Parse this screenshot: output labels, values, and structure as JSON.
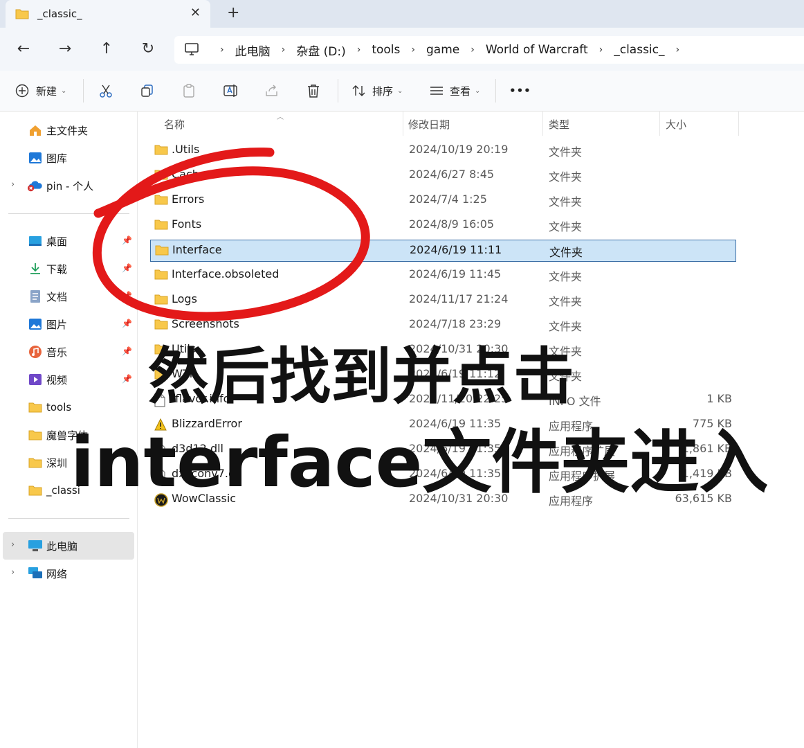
{
  "window": {
    "tab_title": "_classic_",
    "close_glyph": "✕",
    "new_tab_glyph": "+"
  },
  "nav": {
    "back": "←",
    "forward": "→",
    "up": "↑",
    "refresh": "↻"
  },
  "breadcrumbs": [
    "此电脑",
    "杂盘 (D:)",
    "tools",
    "game",
    "World of Warcraft",
    "_classic_"
  ],
  "toolbar": {
    "new_label": "新建",
    "sort_label": "排序",
    "view_label": "查看",
    "more_label": "•••"
  },
  "sidebar": {
    "quick": [
      {
        "label": "主文件夹",
        "icon": "home-icon"
      },
      {
        "label": "图库",
        "icon": "gallery-icon"
      },
      {
        "label": "pin - 个人",
        "icon": "onedrive-icon"
      }
    ],
    "pinned": [
      {
        "label": "桌面",
        "icon": "desktop-icon",
        "pinned": true
      },
      {
        "label": "下载",
        "icon": "download-icon",
        "pinned": true
      },
      {
        "label": "文档",
        "icon": "document-icon",
        "pinned": true
      },
      {
        "label": "图片",
        "icon": "pictures-icon",
        "pinned": true
      },
      {
        "label": "音乐",
        "icon": "music-icon",
        "pinned": true
      },
      {
        "label": "视频",
        "icon": "video-icon",
        "pinned": true
      },
      {
        "label": "tools",
        "icon": "folder-icon",
        "pinned": false
      },
      {
        "label": "魔兽字体",
        "icon": "folder-icon",
        "pinned": false
      },
      {
        "label": "深圳",
        "icon": "folder-icon",
        "pinned": false
      },
      {
        "label": "_classi",
        "icon": "folder-icon",
        "pinned": false
      }
    ],
    "this_pc": "此电脑",
    "network": "网络"
  },
  "columns": {
    "name": "名称",
    "date": "修改日期",
    "type": "类型",
    "size": "大小"
  },
  "files": [
    {
      "name": ".Utils",
      "date": "2024/10/19 20:19",
      "type": "文件夹",
      "size": "",
      "kind": "folder"
    },
    {
      "name": "Cache",
      "date": "2024/6/27 8:45",
      "type": "文件夹",
      "size": "",
      "kind": "folder"
    },
    {
      "name": "Errors",
      "date": "2024/7/4 1:25",
      "type": "文件夹",
      "size": "",
      "kind": "folder"
    },
    {
      "name": "Fonts",
      "date": "2024/8/9 16:05",
      "type": "文件夹",
      "size": "",
      "kind": "folder"
    },
    {
      "name": "Interface",
      "date": "2024/6/19 11:11",
      "type": "文件夹",
      "size": "",
      "kind": "folder",
      "selected": true
    },
    {
      "name": "Interface.obsoleted",
      "date": "2024/6/19 11:45",
      "type": "文件夹",
      "size": "",
      "kind": "folder"
    },
    {
      "name": "Logs",
      "date": "2024/11/17 21:24",
      "type": "文件夹",
      "size": "",
      "kind": "folder"
    },
    {
      "name": "Screenshots",
      "date": "2024/7/18 23:29",
      "type": "文件夹",
      "size": "",
      "kind": "folder"
    },
    {
      "name": "Utils",
      "date": "2024/10/31 20:30",
      "type": "文件夹",
      "size": "",
      "kind": "folder"
    },
    {
      "name": "WTF",
      "date": "2024/6/19 11:12",
      "type": "文件夹",
      "size": "",
      "kind": "folder"
    },
    {
      "name": ".flavor.info",
      "date": "2024/11/20 22:25",
      "type": "INFO 文件",
      "size": "1 KB",
      "kind": "file"
    },
    {
      "name": "BlizzardError",
      "date": "2024/6/19 11:35",
      "type": "应用程序",
      "size": "775 KB",
      "kind": "warn"
    },
    {
      "name": "d3d12.dll",
      "date": "2024/6/19 11:35",
      "type": "应用程序扩展",
      "size": "1,861 KB",
      "kind": "dll"
    },
    {
      "name": "dxilconv7.dll",
      "date": "2024/6/19 11:35",
      "type": "应用程序扩展",
      "size": "1,419 KB",
      "kind": "dll"
    },
    {
      "name": "WowClassic",
      "date": "2024/10/31 20:30",
      "type": "应用程序",
      "size": "63,615 KB",
      "kind": "exe"
    }
  ],
  "overlay": {
    "line1": "然后找到并点击",
    "line2": "interface文件夹进入"
  },
  "colors": {
    "accent_red": "#e31919",
    "selection": "#cce4f7",
    "folder": "#f8c84b"
  }
}
